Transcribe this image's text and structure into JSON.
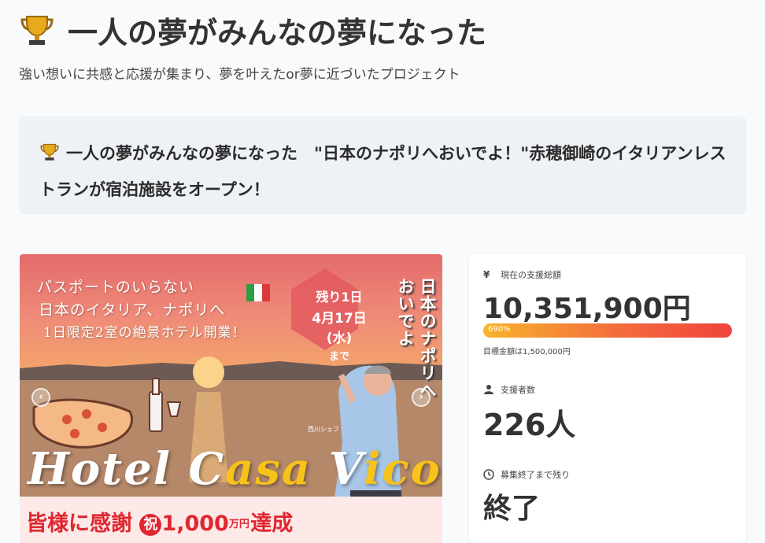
{
  "header": {
    "title": "一人の夢がみんなの夢になった",
    "subtitle": "強い想いに共感と応援が集まり、夢を叶えたor夢に近づいたプロジェクト"
  },
  "project": {
    "title": "一人の夢がみんなの夢になった　\"日本のナポリへおいでよ！\"赤穂御崎のイタリアンレストランが宿泊施設をオープン！"
  },
  "hero": {
    "lines": [
      "パスポートのいらない",
      "日本のイタリア、ナポリへ",
      "1日限定2室の絶景ホテル開業！"
    ],
    "countdown": [
      "残り1日",
      "4月17日(水)",
      "まで"
    ],
    "vertical": "日本のナポリへおいでよ",
    "chef": "西川シェフ",
    "hotel_name_1": "Hotel C",
    "hotel_name_2": "asa",
    "hotel_name_3": " V",
    "hotel_name_4": "ico",
    "thanks": "皆様に感謝",
    "celebrate": "祝",
    "amount": "1,000",
    "unit": "万円",
    "achieved": "達成"
  },
  "stats": {
    "total_label": "現在の支援総額",
    "total_value": "10,351,900円",
    "progress_text": "690%",
    "progress_percent": 100,
    "goal_text": "目標金額は1,500,000円",
    "supporters_label": "支援者数",
    "supporters_value": "226人",
    "remaining_label": "募集終了まで残り",
    "remaining_value": "終了"
  },
  "colors": {
    "accent": "#f0443c",
    "trophy": "#e5a31a"
  },
  "icons": {
    "trophy": "trophy-icon",
    "yen": "yen-icon",
    "person": "person-icon",
    "clock": "clock-icon"
  }
}
